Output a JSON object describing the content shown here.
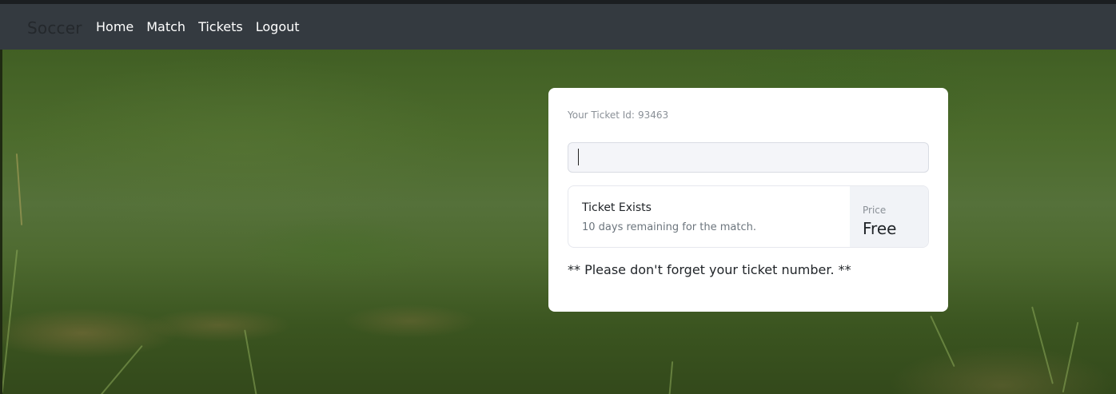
{
  "navbar": {
    "brand": "Soccer",
    "links": [
      "Home",
      "Match",
      "Tickets",
      "Logout"
    ]
  },
  "card": {
    "ticket_id_label": "Your Ticket Id:",
    "ticket_id": "93463",
    "input_value": "",
    "status_title": "Ticket Exists",
    "status_subtitle": "10 days remaining for the match.",
    "price_label": "Price",
    "price_value": "Free",
    "note": "** Please don't forget your ticket number. **"
  },
  "colors": {
    "navbar": "#343a40",
    "card": "#ffffff",
    "input_bg": "#f4f5f9",
    "price_bg": "#f1f3f7"
  }
}
